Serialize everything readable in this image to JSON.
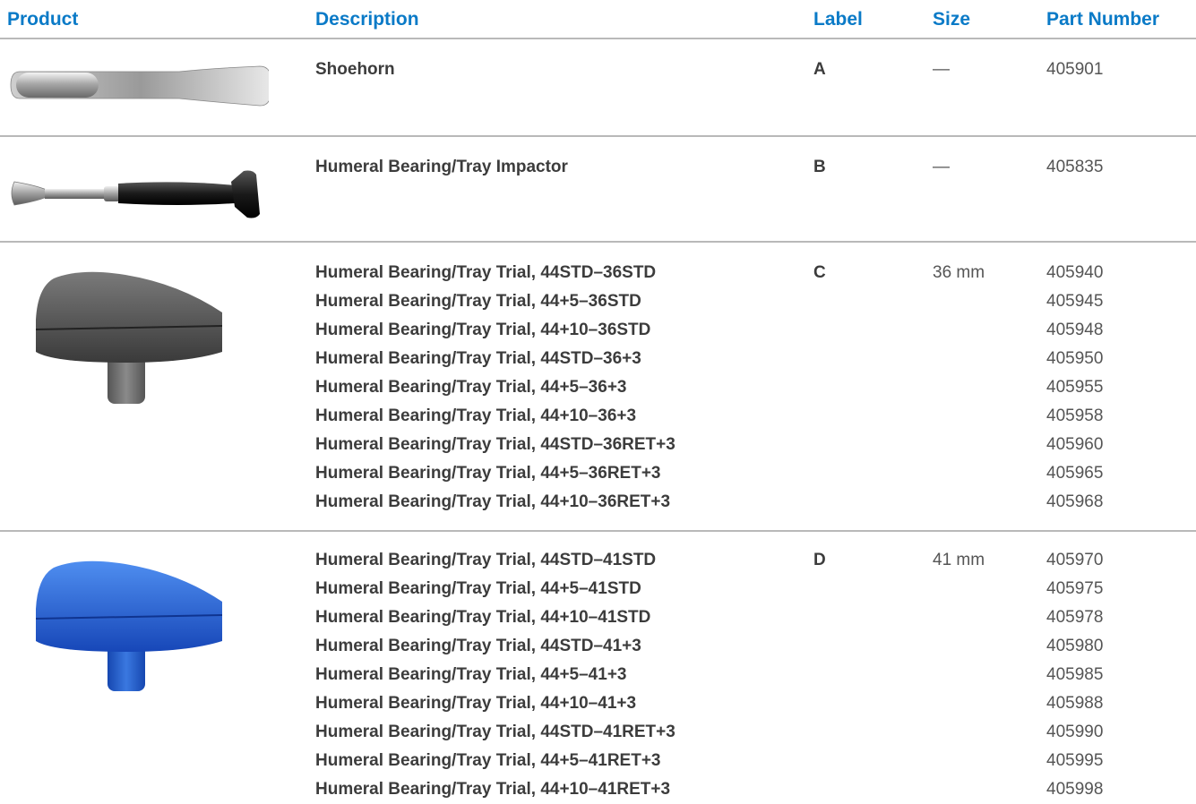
{
  "header": {
    "product": "Product",
    "description": "Description",
    "label": "Label",
    "size": "Size",
    "part_number": "Part Number"
  },
  "rows": [
    {
      "icon": "shoehorn-icon",
      "descriptions": [
        "Shoehorn"
      ],
      "label": "A",
      "size": "—",
      "part_numbers": [
        "405901"
      ]
    },
    {
      "icon": "impactor-icon",
      "descriptions": [
        "Humeral Bearing/Tray Impactor"
      ],
      "label": "B",
      "size": "—",
      "part_numbers": [
        "405835"
      ]
    },
    {
      "icon": "gray-trial-icon",
      "descriptions": [
        "Humeral Bearing/Tray Trial, 44STD–36STD",
        "Humeral Bearing/Tray Trial, 44+5–36STD",
        "Humeral Bearing/Tray Trial, 44+10–36STD",
        "Humeral Bearing/Tray Trial, 44STD–36+3",
        "Humeral Bearing/Tray Trial, 44+5–36+3",
        "Humeral Bearing/Tray Trial, 44+10–36+3",
        "Humeral Bearing/Tray Trial, 44STD–36RET+3",
        "Humeral Bearing/Tray Trial, 44+5–36RET+3",
        "Humeral Bearing/Tray Trial, 44+10–36RET+3"
      ],
      "label": "C",
      "size": "36 mm",
      "part_numbers": [
        "405940",
        "405945",
        "405948",
        "405950",
        "405955",
        "405958",
        "405960",
        "405965",
        "405968"
      ]
    },
    {
      "icon": "blue-trial-icon",
      "descriptions": [
        "Humeral Bearing/Tray Trial, 44STD–41STD",
        "Humeral Bearing/Tray Trial, 44+5–41STD",
        "Humeral Bearing/Tray Trial, 44+10–41STD",
        "Humeral Bearing/Tray Trial, 44STD–41+3",
        "Humeral Bearing/Tray Trial, 44+5–41+3",
        "Humeral Bearing/Tray Trial, 44+10–41+3",
        "Humeral Bearing/Tray Trial, 44STD–41RET+3",
        "Humeral Bearing/Tray Trial, 44+5–41RET+3",
        "Humeral Bearing/Tray Trial, 44+10–41RET+3"
      ],
      "label": "D",
      "size": "41 mm",
      "part_numbers": [
        "405970",
        "405975",
        "405978",
        "405980",
        "405985",
        "405988",
        "405990",
        "405995",
        "405998"
      ]
    }
  ],
  "colors": {
    "header_text": "#0a7ac7",
    "rule": "#b9b9b9",
    "trial_gray": "#4a4a4a",
    "trial_blue": "#1c5bd0"
  }
}
